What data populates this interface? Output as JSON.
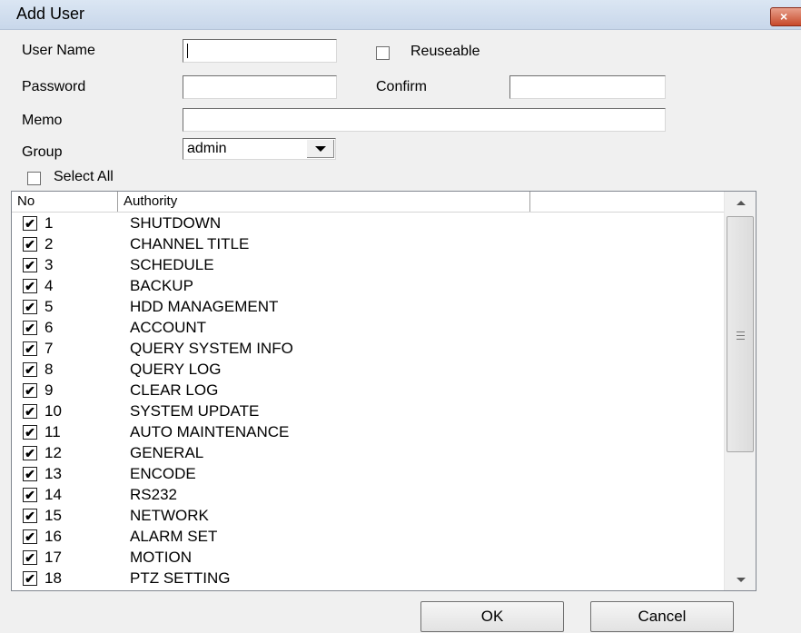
{
  "window": {
    "title": "Add User",
    "close_glyph": "×"
  },
  "form": {
    "user_name_label": "User Name",
    "user_name_value": "",
    "reuseable_label": "Reuseable",
    "reuseable_checked": false,
    "password_label": "Password",
    "password_value": "",
    "confirm_label": "Confirm",
    "confirm_value": "",
    "memo_label": "Memo",
    "memo_value": "",
    "group_label": "Group",
    "group_selected": "admin",
    "select_all_label": "Select All",
    "select_all_checked": false
  },
  "authority_list": {
    "columns": [
      "No",
      "Authority",
      ""
    ],
    "rows": [
      {
        "no": "1",
        "name": "SHUTDOWN",
        "checked": true
      },
      {
        "no": "2",
        "name": "CHANNEL TITLE",
        "checked": true
      },
      {
        "no": "3",
        "name": "SCHEDULE",
        "checked": true
      },
      {
        "no": "4",
        "name": "BACKUP",
        "checked": true
      },
      {
        "no": "5",
        "name": "HDD MANAGEMENT",
        "checked": true
      },
      {
        "no": "6",
        "name": "ACCOUNT",
        "checked": true
      },
      {
        "no": "7",
        "name": "QUERY SYSTEM INFO",
        "checked": true
      },
      {
        "no": "8",
        "name": "QUERY LOG",
        "checked": true
      },
      {
        "no": "9",
        "name": "CLEAR LOG",
        "checked": true
      },
      {
        "no": "10",
        "name": "SYSTEM UPDATE",
        "checked": true
      },
      {
        "no": "11",
        "name": "AUTO MAINTENANCE",
        "checked": true
      },
      {
        "no": "12",
        "name": "GENERAL",
        "checked": true
      },
      {
        "no": "13",
        "name": "ENCODE",
        "checked": true
      },
      {
        "no": "14",
        "name": "RS232",
        "checked": true
      },
      {
        "no": "15",
        "name": "NETWORK",
        "checked": true
      },
      {
        "no": "16",
        "name": "ALARM SET",
        "checked": true
      },
      {
        "no": "17",
        "name": "MOTION",
        "checked": true
      },
      {
        "no": "18",
        "name": "PTZ SETTING",
        "checked": true
      }
    ]
  },
  "buttons": {
    "ok": "OK",
    "cancel": "Cancel"
  },
  "icons": {
    "check": "✔",
    "scroll_up": "up-arrow-icon",
    "scroll_down": "down-arrow-icon",
    "grip": "scroll-grip-icon",
    "dropdown": "chevron-down-icon"
  }
}
